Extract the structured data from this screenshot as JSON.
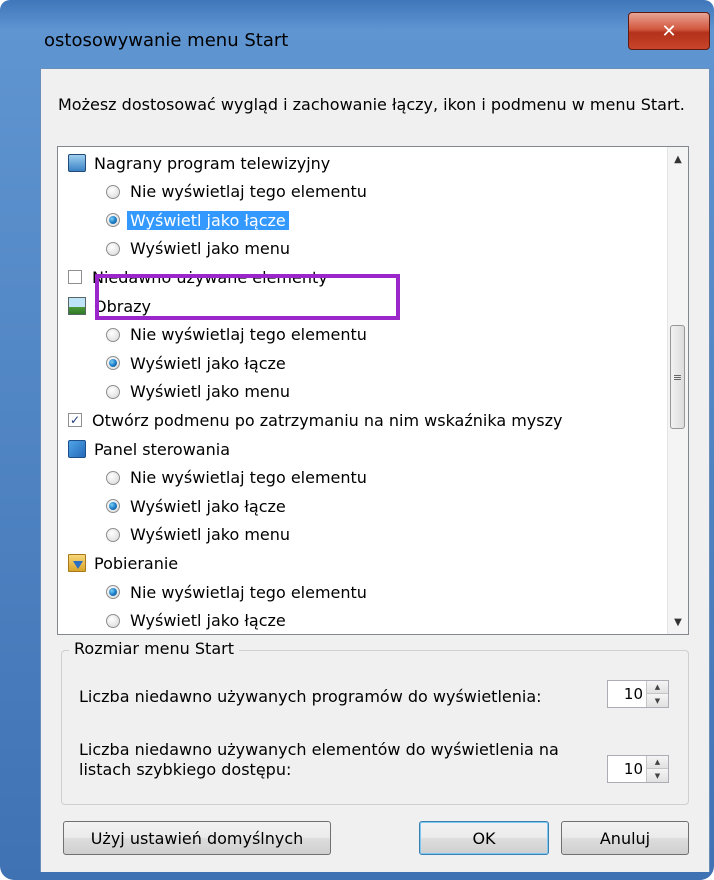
{
  "window": {
    "title": "ostosowywanie menu Start",
    "close_glyph": "✕"
  },
  "description": "Możesz dostosować wygląd i zachowanie łączy, ikon i podmenu w menu Start.",
  "list": {
    "rows": [
      {
        "kind": "header",
        "icon": "tv-icon",
        "text": "Nagrany program telewizyjny"
      },
      {
        "kind": "radio",
        "checked": false,
        "text": "Nie wyświetlaj tego elementu"
      },
      {
        "kind": "radio",
        "checked": true,
        "selected": true,
        "text": "Wyświetl jako łącze"
      },
      {
        "kind": "radio",
        "checked": false,
        "text": "Wyświetl jako menu"
      },
      {
        "kind": "checkbox",
        "checked": false,
        "text": "Niedawno używane elementy"
      },
      {
        "kind": "header",
        "icon": "pictures-icon",
        "text": "Obrazy"
      },
      {
        "kind": "radio",
        "checked": false,
        "text": "Nie wyświetlaj tego elementu"
      },
      {
        "kind": "radio",
        "checked": true,
        "text": "Wyświetl jako łącze"
      },
      {
        "kind": "radio",
        "checked": false,
        "text": "Wyświetl jako menu"
      },
      {
        "kind": "checkbox",
        "checked": true,
        "text": "Otwórz podmenu po zatrzymaniu na nim wskaźnika myszy"
      },
      {
        "kind": "header",
        "icon": "control-panel-icon",
        "text": "Panel sterowania"
      },
      {
        "kind": "radio",
        "checked": false,
        "text": "Nie wyświetlaj tego elementu"
      },
      {
        "kind": "radio",
        "checked": true,
        "text": "Wyświetl jako łącze"
      },
      {
        "kind": "radio",
        "checked": false,
        "text": "Wyświetl jako menu"
      },
      {
        "kind": "header",
        "icon": "downloads-folder-icon",
        "text": "Pobieranie"
      },
      {
        "kind": "radio",
        "checked": true,
        "text": "Nie wyświetlaj tego elementu"
      },
      {
        "kind": "radio",
        "checked": false,
        "text": "Wyświetl jako łącze"
      }
    ],
    "scroll_position": 0.4
  },
  "menu_size": {
    "legend": "Rozmiar menu Start",
    "recent_programs_label": "Liczba niedawno używanych programów do wyświetlenia:",
    "recent_programs_value": "10",
    "recent_items_label": "Liczba niedawno używanych elementów do wyświetlenia na listach szybkiego dostępu:",
    "recent_items_value": "10"
  },
  "buttons": {
    "defaults": "Użyj ustawień domyślnych",
    "ok": "OK",
    "cancel": "Anuluj"
  },
  "colors": {
    "selection": "#3399ff",
    "highlight_annotation": "#9b26c9",
    "title_bar": "#5f95d1"
  }
}
